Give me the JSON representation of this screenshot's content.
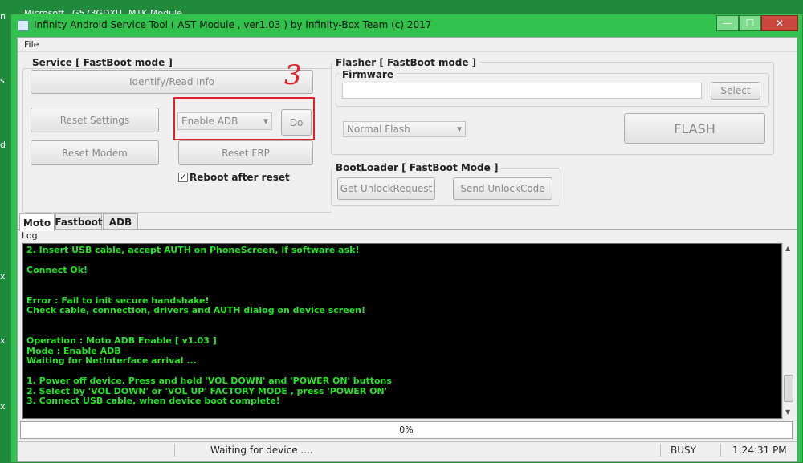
{
  "desktop": {
    "top_labels": [
      "Microsoft",
      "G573GDXU",
      "MTK Module"
    ],
    "left_edge": [
      "n",
      "s",
      "d",
      "x",
      "x",
      "x"
    ]
  },
  "window": {
    "title": "Infinity Android Service Tool ( AST Module , ver1.03  ) by Infinity-Box Team (c) 2017",
    "controls": {
      "minimize": "—",
      "maximize": "☐",
      "close": "✕"
    },
    "menu": [
      "File"
    ]
  },
  "service": {
    "title": "Service [ FastBoot mode ]",
    "identify_label": "Identify/Read Info",
    "reset_settings_label": "Reset Settings",
    "reset_modem_label": "Reset Modem",
    "reset_frp_label": "Reset FRP",
    "combo_value": "Enable ADB",
    "do_label": "Do",
    "reboot_label": "Reboot after reset",
    "reboot_checked": "✓",
    "annotation": "3"
  },
  "flasher": {
    "title": "Flasher [ FastBoot mode ]",
    "firmware_label": "Firmware",
    "firmware_value": "",
    "select_label": "Select",
    "flash_mode_value": "Normal Flash",
    "flash_label": "FLASH"
  },
  "bootloader": {
    "title": "BootLoader [ FastBoot Mode ]",
    "get_unlock_label": "Get UnlockRequest",
    "send_unlock_label": "Send UnlockCode"
  },
  "tabs": [
    "Moto",
    "Fastboot",
    "ADB"
  ],
  "log": {
    "label": "Log",
    "lines": [
      "2. Insert USB cable, accept AUTH on PhoneScreen, if software ask!",
      "Connect Ok!",
      "Error : Fail to init secure handshake!",
      "Check cable, connection, drivers and AUTH dialog on device screen!",
      "Operation : Moto ADB Enable [ v1.03 ]",
      "Mode : Enable ADB",
      "Waiting for NetInterface arrival ...",
      "1. Power off device. Press and hold 'VOL DOWN' and 'POWER ON' buttons",
      "2. Select by 'VOL DOWN' or 'VOL UP' FACTORY MODE , press 'POWER ON'",
      "3. Connect USB cable, when device boot complete!"
    ],
    "text_color": "#27e127"
  },
  "progress": {
    "value": 0,
    "label": "0%"
  },
  "status": {
    "message": "Waiting for device ....",
    "state": "BUSY",
    "time": "1:24:31 PM"
  },
  "colors": {
    "window_frame": "#31c24d",
    "annotation_red": "#e0202a"
  }
}
